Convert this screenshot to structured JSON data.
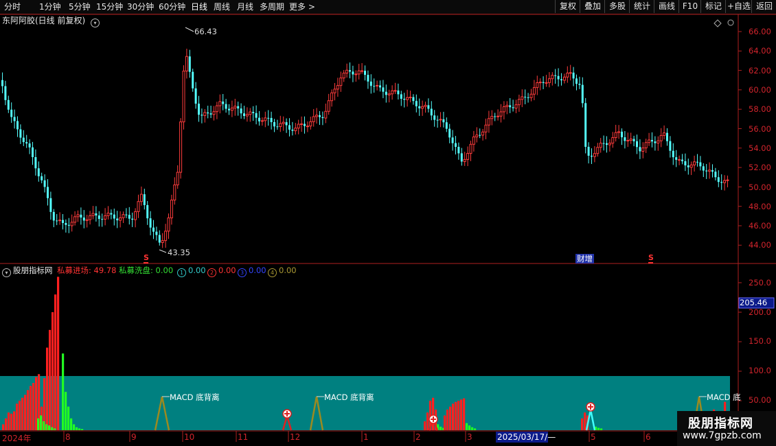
{
  "toolbar": {
    "periods": [
      "分时",
      "1分钟",
      "5分钟",
      "15分钟",
      "30分钟",
      "60分钟",
      "日线",
      "周线",
      "月线",
      "多周期",
      "更多 >"
    ],
    "active_period": "日线",
    "right_buttons": [
      "复权",
      "叠加",
      "多股",
      "统计",
      "画线",
      "F10",
      "标记",
      "+自选",
      "返回"
    ]
  },
  "main_chart": {
    "title": "东阿阿胶(日线 前复权)",
    "high_label": "66.43",
    "low_label": "43.35",
    "event_label": "财增",
    "y_ticks": [
      "66.00",
      "64.00",
      "62.00",
      "60.00",
      "58.00",
      "56.00",
      "54.00",
      "52.00",
      "50.00",
      "48.00",
      "46.00",
      "44.00"
    ],
    "marker_s": "S"
  },
  "indicator": {
    "name": "股朋指标网",
    "items": [
      {
        "label": "私募进场: 49.78",
        "color": "#ff3333"
      },
      {
        "label": "私募洗盘: 0.00",
        "color": "#33dd33"
      },
      {
        "label": "0.00",
        "color": "#33cccc",
        "icon": "①"
      },
      {
        "label": "0.00",
        "color": "#ff3333",
        "icon": "②"
      },
      {
        "label": "0.00",
        "color": "#3344ff",
        "icon": "③"
      },
      {
        "label": "0.00",
        "color": "#aa9933",
        "icon": "④"
      }
    ],
    "y_ticks": [
      "250.0",
      "200.0",
      "150.0",
      "100.0",
      "50.00"
    ],
    "current_value": "205.46",
    "annotations": [
      "MACD 底背离",
      "MACD 底背离",
      "MACD 底"
    ]
  },
  "x_axis": {
    "labels": [
      "2024年",
      "8",
      "9",
      "10",
      "11",
      "12",
      "1",
      "2",
      "3",
      "2025/03/17/—",
      "5",
      "6"
    ]
  },
  "watermark": {
    "text": "股朋指标网",
    "url": "www.7gpzb.com"
  },
  "colors": {
    "up": "#ff3c3c",
    "down": "#54ffff",
    "grid": "#8a1a1a",
    "teal": "#008080"
  }
}
